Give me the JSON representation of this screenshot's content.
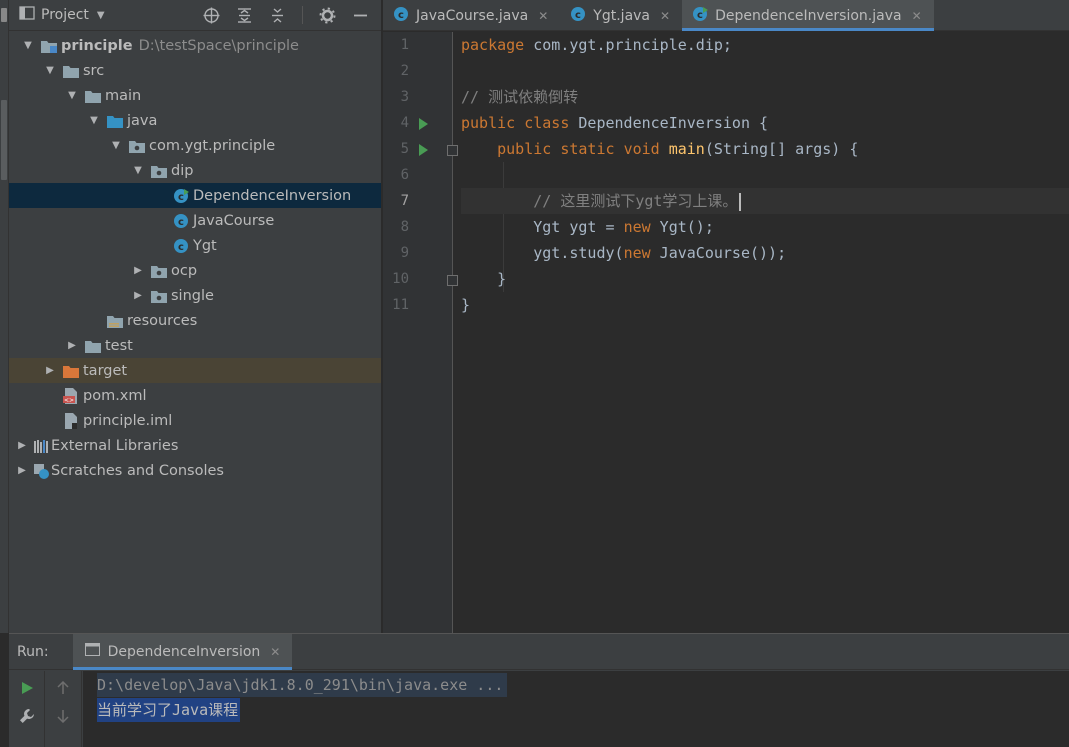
{
  "project_panel": {
    "title": "Project",
    "tree": [
      {
        "label": "principle",
        "path": "D:\\testSpace\\principle",
        "bold": true
      },
      {
        "label": "src"
      },
      {
        "label": "main"
      },
      {
        "label": "java"
      },
      {
        "label": "com.ygt.principle"
      },
      {
        "label": "dip"
      },
      {
        "label": "DependenceInversion",
        "selected": true
      },
      {
        "label": "JavaCourse"
      },
      {
        "label": "Ygt"
      },
      {
        "label": "ocp"
      },
      {
        "label": "single"
      },
      {
        "label": "resources"
      },
      {
        "label": "test"
      },
      {
        "label": "target"
      },
      {
        "label": "pom.xml"
      },
      {
        "label": "principle.iml"
      },
      {
        "label": "External Libraries"
      },
      {
        "label": "Scratches and Consoles"
      }
    ]
  },
  "editor_tabs": [
    {
      "label": "JavaCourse.java"
    },
    {
      "label": "Ygt.java"
    },
    {
      "label": "DependenceInversion.java",
      "active": true
    }
  ],
  "editor": {
    "line_numbers": [
      "1",
      "2",
      "3",
      "4",
      "5",
      "6",
      "7",
      "8",
      "9",
      "10",
      "11"
    ],
    "current_line": 7,
    "code": {
      "l1_kw": "package",
      "l1_rest": " com.ygt.principle.dip;",
      "l3_comment": "// 测试依赖倒转",
      "l4_kw1": "public",
      "l4_kw2": "class",
      "l4_name": " DependenceInversion {",
      "l5_kw1": "public",
      "l5_kw2": "static",
      "l5_kw3": "void",
      "l5_fn": "main",
      "l5_rest": "(String[] args) {",
      "l7_comment": "// 这里测试下ygt学习上课。",
      "l8_a": "Ygt ygt = ",
      "l8_kw": "new",
      "l8_b": " Ygt();",
      "l9_a": "ygt.study(",
      "l9_kw": "new",
      "l9_b": " JavaCourse());",
      "l10": "}",
      "l11": "}"
    }
  },
  "run_panel": {
    "label": "Run:",
    "tab_label": "DependenceInversion",
    "console": [
      "D:\\develop\\Java\\jdk1.8.0_291\\bin\\java.exe ...",
      "当前学习了Java课程"
    ]
  }
}
